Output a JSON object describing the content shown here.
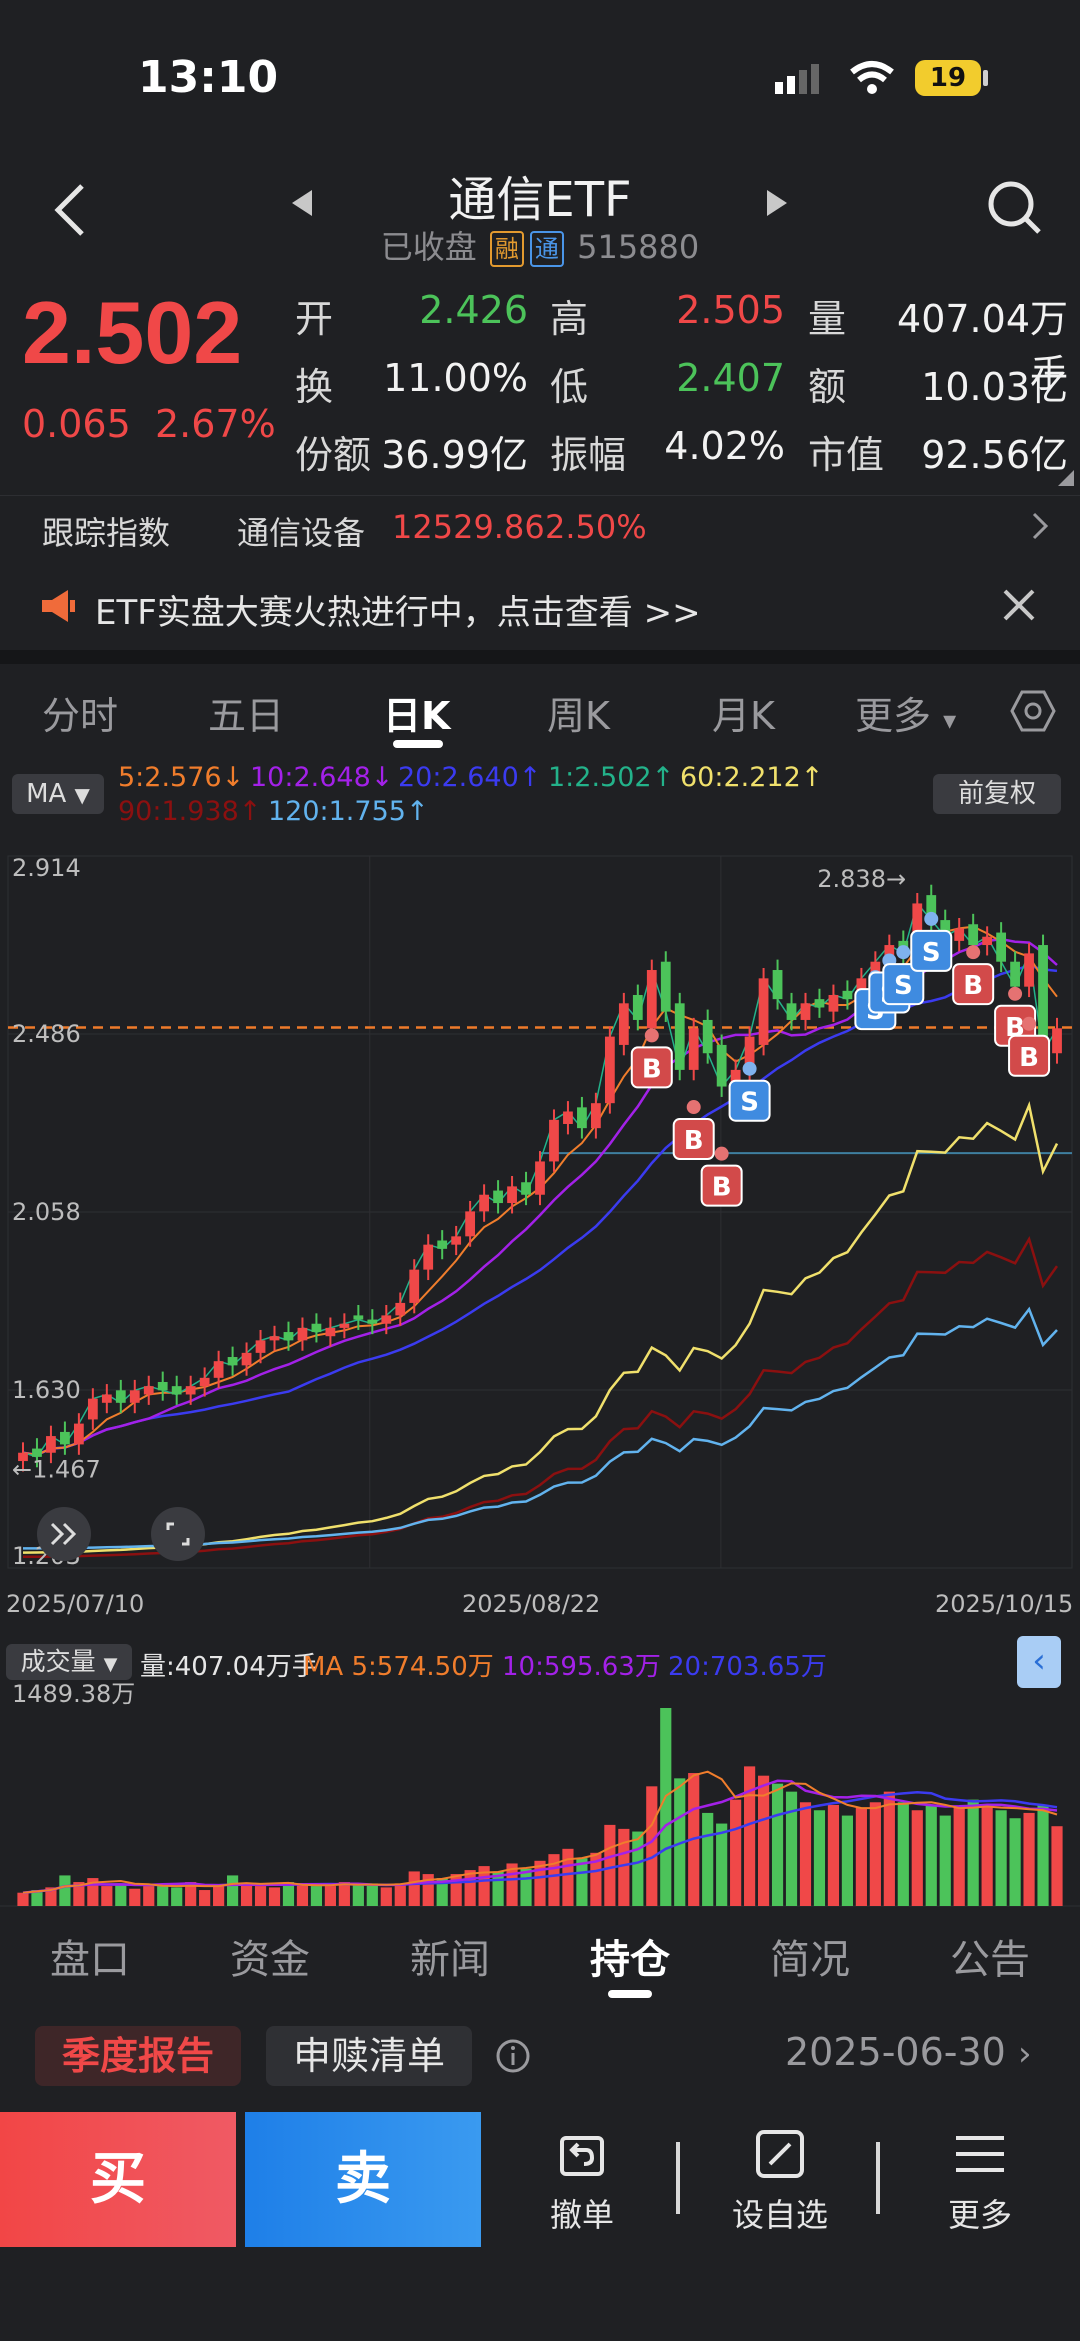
{
  "status_bar": {
    "time": "13:10",
    "battery": "19"
  },
  "header": {
    "title": "通信ETF",
    "status": "已收盘",
    "tag_margin": "融",
    "tag_connect": "通",
    "code": "515880"
  },
  "quote": {
    "price": "2.502",
    "change": "0.065",
    "change_pct": "2.67%",
    "open_label": "开",
    "open": "2.426",
    "high_label": "高",
    "high": "2.505",
    "volume_label": "量",
    "volume": "407.04万手",
    "turnover_label": "换",
    "turnover": "11.00%",
    "low_label": "低",
    "low": "2.407",
    "amount_label": "额",
    "amount": "10.03亿",
    "shares_label": "份额",
    "shares": "36.99亿",
    "amplitude_label": "振幅",
    "amplitude": "4.02%",
    "mktcap_label": "市值",
    "mktcap": "92.56亿"
  },
  "tracking": {
    "label": "跟踪指数",
    "index_name": "通信设备",
    "index_value": "12529.86",
    "index_pct": "2.50%"
  },
  "notice": {
    "text": "ETF实盘大赛火热进行中，点击查看 >>"
  },
  "period_tabs": [
    "分时",
    "五日",
    "日K",
    "周K",
    "月K",
    "更多"
  ],
  "active_period": "日K",
  "indicator": {
    "name": "MA",
    "ma5": "5:2.576",
    "ma10": "10:2.648",
    "ma20": "20:2.640",
    "ma1": "1:2.502",
    "ma60": "60:2.212",
    "ma90": "90:1.938",
    "ma120": "120:1.755",
    "adjust": "前复权",
    "colors": {
      "ma5": "#f07d2c",
      "ma10": "#a321e8",
      "ma20": "#3b3bf0",
      "ma1": "#23b28a",
      "ma60": "#f0e06c",
      "ma90": "#8b1010",
      "ma120": "#62b3ee"
    }
  },
  "chart_data": [
    {
      "type": "candlestick",
      "y_ticks": [
        "2.914",
        "2.486",
        "2.058",
        "1.630",
        "1.203"
      ],
      "ylim": [
        1.203,
        2.914
      ],
      "x_labels": [
        "2025/07/10",
        "2025/08/22",
        "2025/10/15"
      ],
      "annotations": {
        "max_label": "2.838",
        "min_label": "1.467",
        "buy_marker": "B",
        "sell_marker": "S"
      },
      "reference_line": 2.502,
      "closes": [
        1.48,
        1.47,
        1.52,
        1.5,
        1.55,
        1.61,
        1.62,
        1.6,
        1.63,
        1.64,
        1.63,
        1.62,
        1.64,
        1.66,
        1.7,
        1.69,
        1.72,
        1.75,
        1.76,
        1.75,
        1.78,
        1.77,
        1.78,
        1.79,
        1.8,
        1.79,
        1.81,
        1.84,
        1.92,
        1.98,
        1.97,
        2.0,
        2.06,
        2.1,
        2.08,
        2.12,
        2.1,
        2.18,
        2.28,
        2.3,
        2.26,
        2.32,
        2.48,
        2.56,
        2.52,
        2.64,
        2.54,
        2.4,
        2.5,
        2.44,
        2.36,
        2.4,
        2.48,
        2.62,
        2.57,
        2.52,
        2.56,
        2.55,
        2.58,
        2.57,
        2.62,
        2.66,
        2.7,
        2.68,
        2.8,
        2.76,
        2.72,
        2.74,
        2.7,
        2.72,
        2.66,
        2.6,
        2.68,
        2.44,
        2.5
      ],
      "opens": [
        1.46,
        1.49,
        1.48,
        1.53,
        1.5,
        1.56,
        1.6,
        1.63,
        1.6,
        1.62,
        1.65,
        1.64,
        1.62,
        1.64,
        1.66,
        1.71,
        1.69,
        1.72,
        1.75,
        1.77,
        1.75,
        1.79,
        1.76,
        1.78,
        1.81,
        1.8,
        1.79,
        1.81,
        1.84,
        1.92,
        1.99,
        1.98,
        2.0,
        2.06,
        2.11,
        2.08,
        2.13,
        2.1,
        2.18,
        2.27,
        2.31,
        2.26,
        2.32,
        2.46,
        2.58,
        2.5,
        2.66,
        2.56,
        2.4,
        2.52,
        2.46,
        2.36,
        2.4,
        2.46,
        2.64,
        2.56,
        2.52,
        2.57,
        2.54,
        2.59,
        2.57,
        2.62,
        2.66,
        2.71,
        2.68,
        2.82,
        2.76,
        2.71,
        2.75,
        2.7,
        2.73,
        2.66,
        2.6,
        2.7,
        2.44
      ],
      "volumes_wan": [
        100,
        120,
        140,
        230,
        180,
        210,
        150,
        170,
        130,
        160,
        150,
        140,
        180,
        120,
        160,
        230,
        170,
        150,
        140,
        180,
        160,
        150,
        150,
        180,
        160,
        170,
        140,
        170,
        260,
        240,
        210,
        240,
        270,
        300,
        260,
        320,
        280,
        340,
        390,
        430,
        360,
        400,
        610,
        580,
        560,
        900,
        1489,
        960,
        1000,
        700,
        620,
        800,
        1050,
        980,
        920,
        860,
        780,
        720,
        760,
        680,
        740,
        780,
        860,
        780,
        720,
        760,
        680,
        740,
        800,
        760,
        720,
        660,
        700,
        760,
        600
      ],
      "volume_y_tick": "1489.38万"
    }
  ],
  "volume": {
    "name": "成交量",
    "value": "量:407.04万手",
    "ma5": "MA 5:574.50万",
    "ma10": "10:595.63万",
    "ma20": "20:703.65万"
  },
  "bottom_tabs": [
    "盘口",
    "资金",
    "新闻",
    "持仓",
    "简况",
    "公告"
  ],
  "active_bottom_tab": "持仓",
  "holdings": {
    "report": "季度报告",
    "redeem": "申赎清单",
    "date": "2025-06-30"
  },
  "actions": {
    "buy": "买",
    "sell": "卖",
    "cancel": "撤单",
    "watchlist": "设自选",
    "more": "更多"
  }
}
